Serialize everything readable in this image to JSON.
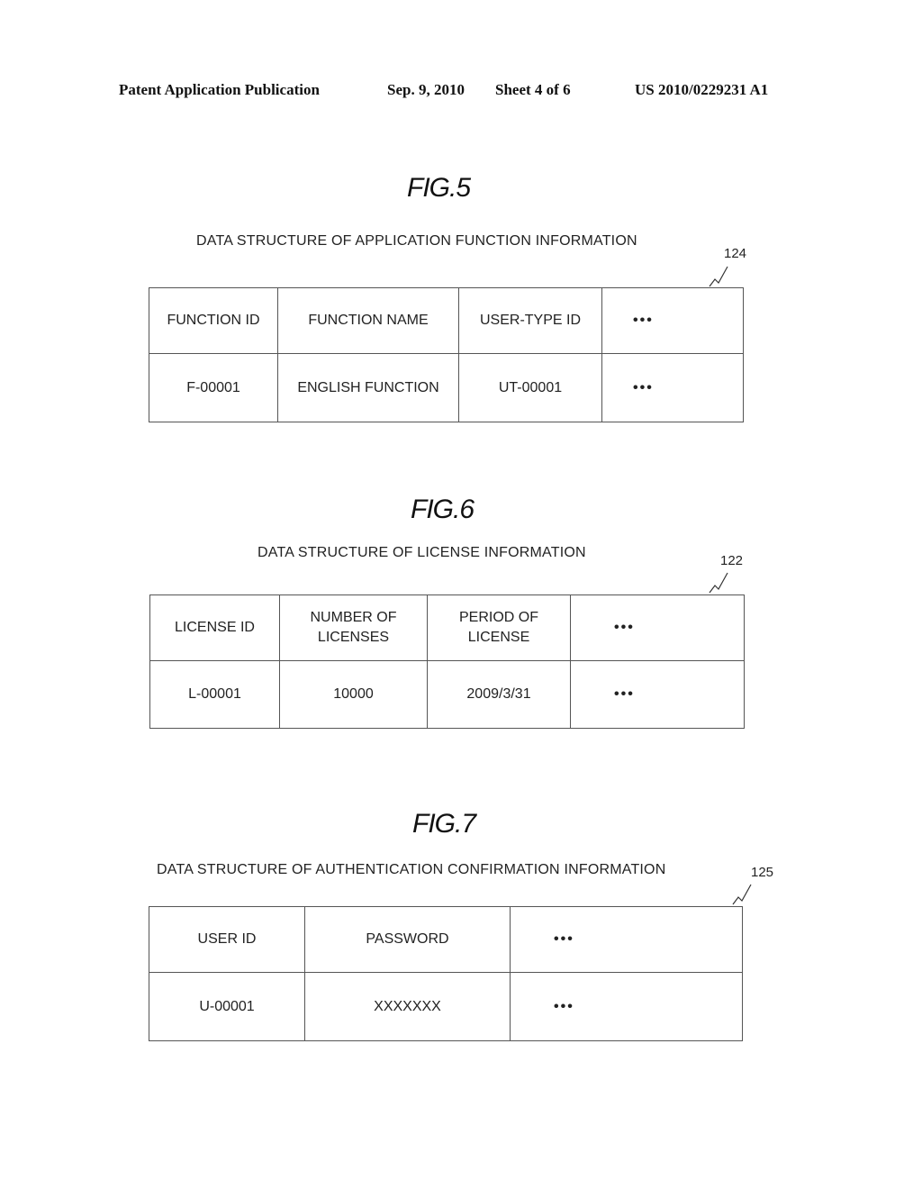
{
  "header": {
    "publication": "Patent Application Publication",
    "date": "Sep. 9, 2010",
    "sheet": "Sheet 4 of 6",
    "number": "US 2010/0229231 A1"
  },
  "figures": [
    {
      "label": "FIG.5",
      "caption": "DATA STRUCTURE OF APPLICATION FUNCTION INFORMATION",
      "ref": "124",
      "headers": [
        "FUNCTION ID",
        "FUNCTION NAME",
        "USER-TYPE ID",
        "•••"
      ],
      "row": [
        "F-00001",
        "ENGLISH FUNCTION",
        "UT-00001",
        "•••"
      ]
    },
    {
      "label": "FIG.6",
      "caption": "DATA STRUCTURE OF LICENSE INFORMATION",
      "ref": "122",
      "headers": [
        "LICENSE ID",
        "NUMBER OF LICENSES",
        "PERIOD OF LICENSE",
        "•••"
      ],
      "row": [
        "L-00001",
        "10000",
        "2009/3/31",
        "•••"
      ]
    },
    {
      "label": "FIG.7",
      "caption": "DATA STRUCTURE OF AUTHENTICATION CONFIRMATION INFORMATION",
      "ref": "125",
      "headers": [
        "USER ID",
        "PASSWORD",
        "•••"
      ],
      "row": [
        "U-00001",
        "XXXXXXX",
        "•••"
      ]
    }
  ]
}
